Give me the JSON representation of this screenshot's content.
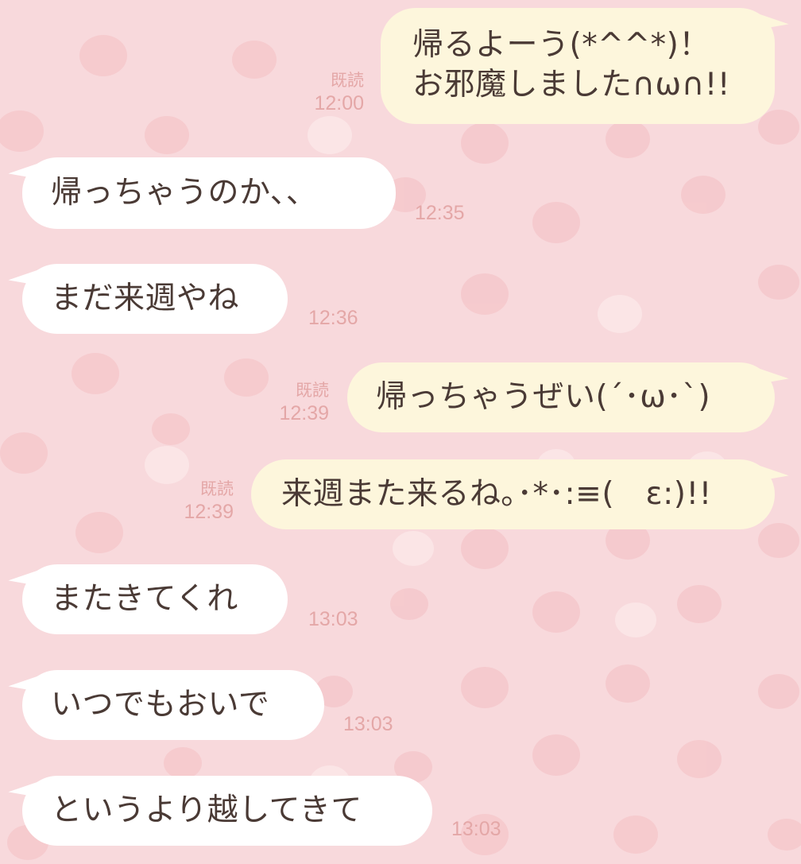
{
  "chat": {
    "background_color": "#f8d9dc",
    "bubble_in_color": "#ffffff",
    "bubble_out_color": "#fdf6dc",
    "meta_color": "#e4a7a7",
    "messages": [
      {
        "direction": "out",
        "lines": [
          "帰るよーう(*^^*)！",
          "お邪魔しました∩ω∩!!"
        ],
        "read": "既読",
        "time": "12:00"
      },
      {
        "direction": "in",
        "text": "帰っちゃうのか、、",
        "time": "12:35"
      },
      {
        "direction": "in",
        "text": "まだ来週やね",
        "time": "12:36"
      },
      {
        "direction": "out",
        "text": "帰っちゃうぜい(´･ω･`)",
        "read": "既読",
        "time": "12:39"
      },
      {
        "direction": "out",
        "text": "来週また来るね｡･*･:≡(　ε:)!!",
        "read": "既読",
        "time": "12:39"
      },
      {
        "direction": "in",
        "text": "またきてくれ",
        "time": "13:03"
      },
      {
        "direction": "in",
        "text": "いつでもおいで",
        "time": "13:03"
      },
      {
        "direction": "in",
        "text": "というより越してきて",
        "time": "13:03"
      }
    ]
  }
}
